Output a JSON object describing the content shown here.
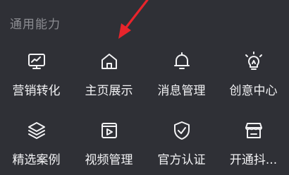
{
  "section": {
    "title": "通用能力"
  },
  "items": [
    {
      "label": "营销转化",
      "icon": "chart-monitor-icon"
    },
    {
      "label": "主页展示",
      "icon": "home-icon"
    },
    {
      "label": "消息管理",
      "icon": "bell-icon"
    },
    {
      "label": "创意中心",
      "icon": "lightbulb-icon"
    },
    {
      "label": "精选案例",
      "icon": "layers-icon"
    },
    {
      "label": "视频管理",
      "icon": "video-icon"
    },
    {
      "label": "官方认证",
      "icon": "shield-check-icon"
    },
    {
      "label": "开通抖...",
      "icon": "store-icon"
    }
  ],
  "colors": {
    "background": "#2f3036",
    "text": "#f2f2f4",
    "section_title": "#8c8d92",
    "arrow": "#e8242b"
  }
}
